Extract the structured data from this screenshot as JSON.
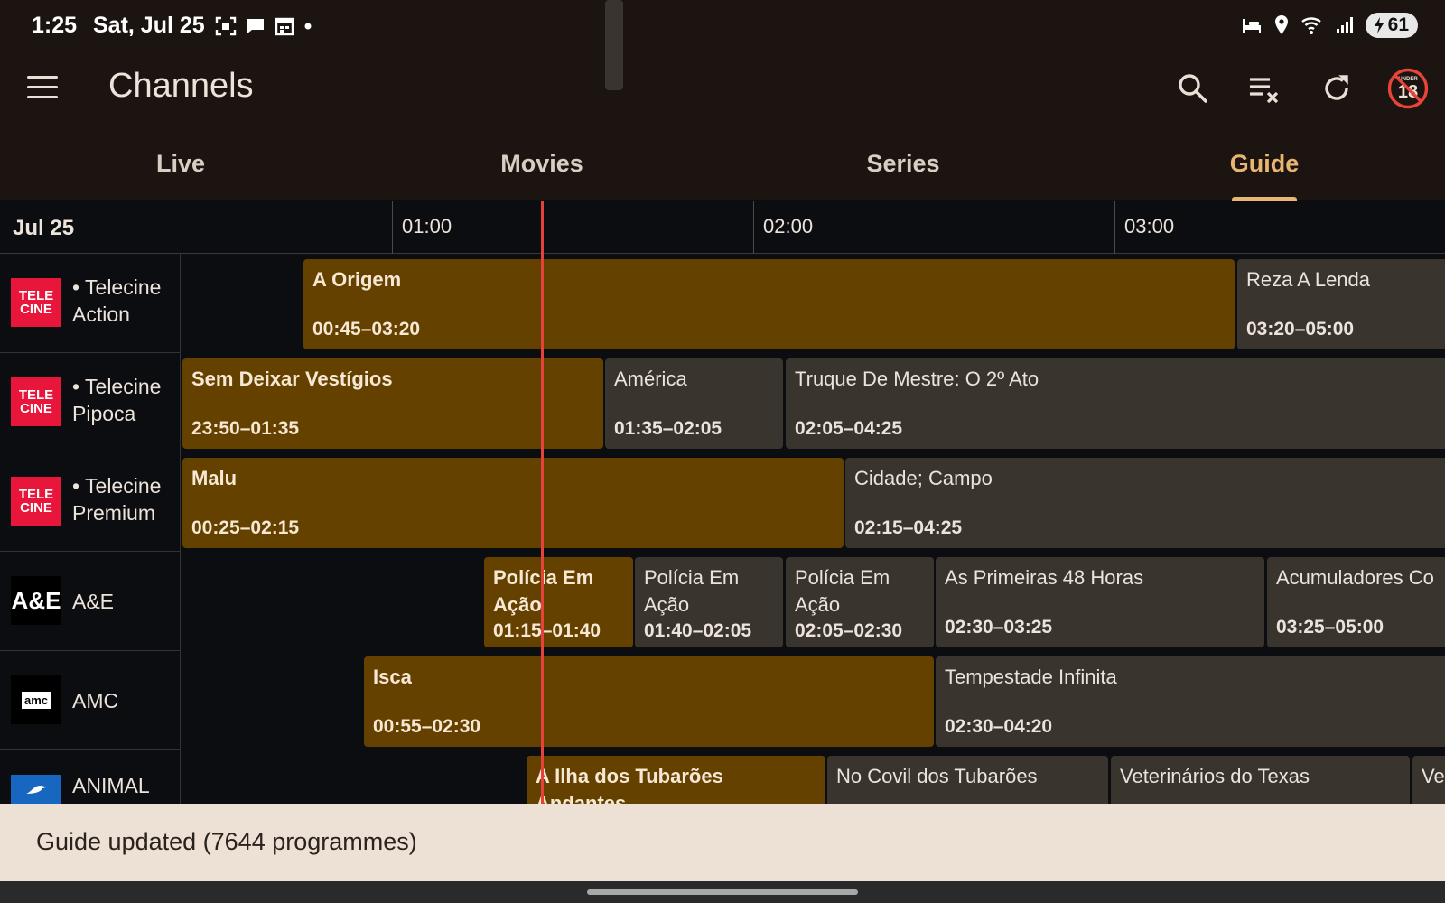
{
  "status_bar": {
    "time": "1:25",
    "date": "Sat, Jul 25",
    "battery": "61",
    "icons": [
      "screenshot-icon",
      "message-icon",
      "calendar-icon",
      "dot-icon",
      "bed-icon",
      "location-icon",
      "wifi-icon",
      "signal-icon",
      "battery-icon"
    ]
  },
  "app_bar": {
    "title": "Channels",
    "actions": [
      "search-icon",
      "clear-list-icon",
      "refresh-icon",
      "under-18-icon"
    ],
    "under18_label": "UNDER",
    "under18_num": "18"
  },
  "tabs": [
    {
      "label": "Live",
      "active": false
    },
    {
      "label": "Movies",
      "active": false
    },
    {
      "label": "Series",
      "active": false
    },
    {
      "label": "Guide",
      "active": true
    }
  ],
  "guide": {
    "date": "Jul 25",
    "ticks": [
      "01:00",
      "02:00",
      "03:00"
    ],
    "now_time": "01:25",
    "channels": [
      {
        "bullet": "• ",
        "name1": "Telecine",
        "name2": "Action",
        "logo": "telecine",
        "programmes": [
          {
            "title": "A Origem",
            "time": "00:45–03:20",
            "current": true
          },
          {
            "title": "Reza A Lenda",
            "time": "03:20–05:00",
            "current": false
          }
        ]
      },
      {
        "bullet": "• ",
        "name1": "Telecine",
        "name2": "Pipoca",
        "logo": "telecine",
        "programmes": [
          {
            "title": "Sem Deixar Vestígios",
            "time": "23:50–01:35",
            "current": true
          },
          {
            "title": "América",
            "time": "01:35–02:05",
            "current": false
          },
          {
            "title": "Truque De Mestre: O 2º Ato",
            "time": "02:05–04:25",
            "current": false
          }
        ]
      },
      {
        "bullet": "• ",
        "name1": "Telecine",
        "name2": "Premium",
        "logo": "telecine",
        "programmes": [
          {
            "title": "Malu",
            "time": "00:25–02:15",
            "current": true
          },
          {
            "title": "Cidade; Campo",
            "time": "02:15–04:25",
            "current": false
          }
        ]
      },
      {
        "name": "A&E",
        "logo": "ae",
        "programmes": [
          {
            "title": "Polícia Em Ação",
            "time": "01:15–01:40",
            "current": true
          },
          {
            "title": "Polícia Em Ação",
            "time": "01:40–02:05",
            "current": false
          },
          {
            "title": "Polícia Em Ação",
            "time": "02:05–02:30",
            "current": false
          },
          {
            "title": "As Primeiras 48 Horas",
            "time": "02:30–03:25",
            "current": false
          },
          {
            "title": "Acumuladores Co",
            "time": "03:25–05:00",
            "current": false
          }
        ]
      },
      {
        "name": "AMC",
        "logo": "amc",
        "programmes": [
          {
            "title": "Isca",
            "time": "00:55–02:30",
            "current": true
          },
          {
            "title": "Tempestade Infinita",
            "time": "02:30–04:20",
            "current": false
          }
        ]
      },
      {
        "name": "ANIMAL",
        "logo": "animal",
        "programmes": [
          {
            "title": "A Ilha dos Tubarões Andantes",
            "current": true
          },
          {
            "title": "No Covil dos Tubarões",
            "current": false
          },
          {
            "title": "Veterinários do Texas",
            "current": false
          },
          {
            "title": "Ve",
            "current": false
          }
        ]
      }
    ]
  },
  "logos": {
    "telecine_top": "TELE",
    "telecine_bottom": "CINE",
    "ae": "A&E",
    "amc": "amc"
  },
  "snackbar": {
    "message": "Guide updated (7644 programmes)"
  },
  "colors": {
    "accent": "#e9b572",
    "current_programme": "#654100",
    "other_programme": "#3a342e",
    "now_line": "#e5423c"
  }
}
